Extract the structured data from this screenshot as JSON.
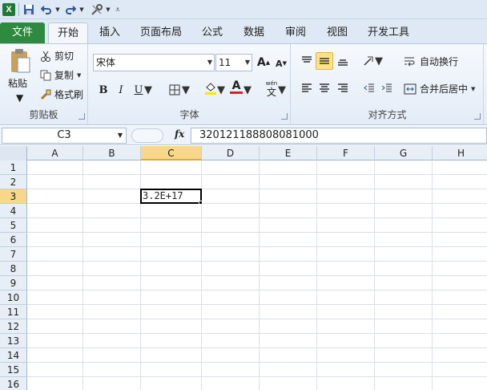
{
  "qat": {
    "logo": "X",
    "icons": [
      "save-icon",
      "undo-icon",
      "redo-icon",
      "tools-icon",
      "customize-icon"
    ]
  },
  "tabs": [
    {
      "label": "文件",
      "active": false,
      "file": true
    },
    {
      "label": "开始",
      "active": true
    },
    {
      "label": "插入"
    },
    {
      "label": "页面布局"
    },
    {
      "label": "公式"
    },
    {
      "label": "数据"
    },
    {
      "label": "审阅"
    },
    {
      "label": "视图"
    },
    {
      "label": "开发工具"
    }
  ],
  "ribbon": {
    "clipboard": {
      "paste": "粘贴",
      "cut": "剪切",
      "copy": "复制",
      "format_painter": "格式刷",
      "label": "剪贴板"
    },
    "font": {
      "name": "宋体",
      "size": "11",
      "bold": "B",
      "italic": "I",
      "underline": "U",
      "grow": "A",
      "shrink": "A",
      "font_color": "A",
      "phonetic": "文",
      "label": "字体",
      "font_color_hex": "#e02020",
      "fill_color_hex": "#ffe600"
    },
    "alignment": {
      "wrap": "自动换行",
      "merge": "合并后居中",
      "label": "对齐方式"
    }
  },
  "formula_bar": {
    "name_box": "C3",
    "fx": "fx",
    "value": "320121188808081000"
  },
  "grid": {
    "columns": [
      "A",
      "B",
      "C",
      "D",
      "E",
      "F",
      "G",
      "H"
    ],
    "rows": [
      "1",
      "2",
      "3",
      "4",
      "5",
      "6",
      "7",
      "8",
      "9",
      "10",
      "11",
      "12",
      "13",
      "14",
      "15",
      "16"
    ],
    "selected_column": "C",
    "selected_row": "3",
    "active_cell_value": "3.2E+17"
  }
}
